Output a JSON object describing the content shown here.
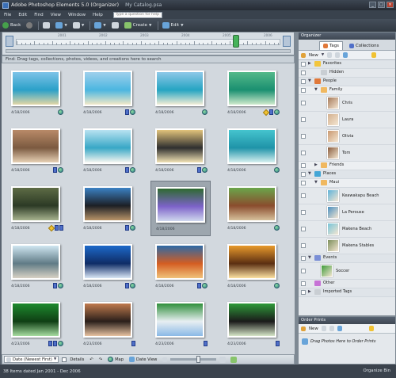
{
  "window": {
    "title": "Adobe Photoshop Elements 5.0 (Organizer)",
    "catalog": "My Catalog.psa"
  },
  "menu": {
    "items": [
      "File",
      "Edit",
      "Find",
      "View",
      "Window",
      "Help"
    ],
    "question_placeholder": "Type a question for help"
  },
  "toolbar": {
    "back_label": "Back",
    "create_label": "Create",
    "edit_label": "Edit"
  },
  "timeline": {
    "years": [
      "2001",
      "2002",
      "2003",
      "2004",
      "2005",
      "2006"
    ],
    "selected_position": 0.82
  },
  "find_bar": {
    "text": "Find: Drag tags, collections, photos, videos, and creations here to search"
  },
  "photos": [
    {
      "date": "4/18/2006",
      "palette": [
        "#7dc3e8",
        "#2aa0c8",
        "#e2d7a6"
      ],
      "badges": [
        "globe"
      ]
    },
    {
      "date": "4/18/2006",
      "palette": [
        "#9fd0ec",
        "#4bb6e0",
        "#f2e9c8"
      ],
      "badges": [
        "tag",
        "globe"
      ]
    },
    {
      "date": "4/18/2006",
      "palette": [
        "#8ec8e8",
        "#25a4c2",
        "#f3eed6"
      ],
      "badges": [
        "globe"
      ]
    },
    {
      "date": "4/18/2006",
      "palette": [
        "#54b98a",
        "#1a8f70",
        "#cfeacc"
      ],
      "badges": [
        "star",
        "tag",
        "globe"
      ]
    },
    {
      "date": "4/18/2006",
      "palette": [
        "#b98a68",
        "#7b5a40",
        "#e7d1b5"
      ],
      "badges": [
        "tag",
        "globe"
      ]
    },
    {
      "date": "4/18/2006",
      "palette": [
        "#b9e2f1",
        "#38a7c6",
        "#f6f6f1"
      ],
      "badges": [
        "tag",
        "globe"
      ]
    },
    {
      "date": "4/18/2006",
      "palette": [
        "#e2c37b",
        "#2f2f2f",
        "#f2e3b6"
      ],
      "badges": [
        "tag",
        "globe"
      ]
    },
    {
      "date": "4/18/2006",
      "palette": [
        "#45c4ce",
        "#1f93a8",
        "#d7f0f0"
      ],
      "badges": [
        "globe"
      ]
    },
    {
      "date": "4/18/2006",
      "palette": [
        "#5d6b45",
        "#2c3a25",
        "#a7b38e"
      ],
      "badges": [
        "star",
        "tag",
        "tag"
      ]
    },
    {
      "date": "4/18/2006",
      "palette": [
        "#3b82c4",
        "#1c1f25",
        "#b89468"
      ],
      "badges": [
        "tag",
        "globe"
      ]
    },
    {
      "date": "4/18/2006",
      "palette": [
        "#2e6a30",
        "#7d63c9",
        "#cfd8ee"
      ],
      "badges": []
    },
    {
      "date": "4/18/2006",
      "palette": [
        "#6aa64b",
        "#8a4c2d",
        "#d6c19c"
      ],
      "badges": [
        "globe"
      ]
    },
    {
      "date": "4/18/2006",
      "palette": [
        "#cfe6f1",
        "#607b86",
        "#d8d1c4"
      ],
      "badges": [
        "tag",
        "globe"
      ]
    },
    {
      "date": "4/18/2006",
      "palette": [
        "#1d69c9",
        "#0f2c66",
        "#d9e6f6"
      ],
      "badges": [
        "tag",
        "globe"
      ]
    },
    {
      "date": "4/18/2006",
      "palette": [
        "#2d6aa6",
        "#d45d22",
        "#f0c27a"
      ],
      "badges": [
        "tag",
        "globe"
      ]
    },
    {
      "date": "4/18/2006",
      "palette": [
        "#e89a2c",
        "#5b2f12",
        "#fce1a2"
      ],
      "badges": [
        "globe"
      ]
    },
    {
      "date": "4/23/2006",
      "palette": [
        "#1e8a2e",
        "#0f3f14",
        "#a6dca0"
      ],
      "badges": [
        "tag",
        "tag",
        "globe"
      ]
    },
    {
      "date": "4/23/2006",
      "palette": [
        "#c07a4e",
        "#2a1f1a",
        "#e7c2a1"
      ],
      "badges": [
        "tag"
      ]
    },
    {
      "date": "4/23/2006",
      "palette": [
        "#2f8f3b",
        "#e8eef2",
        "#8ab9e6"
      ],
      "badges": [
        "tag"
      ]
    },
    {
      "date": "4/23/2006",
      "palette": [
        "#2f9b3a",
        "#1a1a1a",
        "#d6e6c8"
      ],
      "badges": [
        "tag"
      ]
    }
  ],
  "status": {
    "sort_label": "Date (Newest First)",
    "details_label": "Details",
    "map_label": "Map",
    "date_view_label": "Date View"
  },
  "footer": {
    "items_text": "38 Items dated Jan 2001 - Dec 2006",
    "organize_bin": "Organize Bin"
  },
  "organizer": {
    "title": "Organizer",
    "tab_tags": "Tags",
    "tab_collections": "Collections",
    "new_label": "New",
    "rows": [
      {
        "label": "Favorites",
        "kind": "group",
        "icon": "#f2c53d",
        "indent": 20
      },
      {
        "label": "Hidden",
        "kind": "item",
        "icon": "#c9ced3",
        "indent": 28
      },
      {
        "label": "People",
        "kind": "group",
        "icon": "#e0783a",
        "indent": 20
      },
      {
        "label": "Family",
        "kind": "subgroup",
        "icon": "#f0b860",
        "indent": 28
      },
      {
        "label": "Chris",
        "kind": "tall",
        "thumb": "#a67b5b",
        "indent": 36
      },
      {
        "label": "Laura",
        "kind": "tall",
        "thumb": "#d3b08f",
        "indent": 36
      },
      {
        "label": "Olivia",
        "kind": "tall",
        "thumb": "#c99870",
        "indent": 36
      },
      {
        "label": "Tom",
        "kind": "tall",
        "thumb": "#8a5e3f",
        "indent": 36
      },
      {
        "label": "Friends",
        "kind": "subgroup",
        "icon": "#f0b860",
        "indent": 28
      },
      {
        "label": "Places",
        "kind": "group",
        "icon": "#43a6d6",
        "indent": 20
      },
      {
        "label": "Maui",
        "kind": "subgroup",
        "icon": "#f0b860",
        "indent": 28
      },
      {
        "label": "Keawakapu Beach",
        "kind": "tall",
        "thumb": "#5fb3d9",
        "indent": 36
      },
      {
        "label": "La Perouse",
        "kind": "tall",
        "thumb": "#4a8fbf",
        "indent": 36
      },
      {
        "label": "Makena Beach",
        "kind": "tall",
        "thumb": "#78c4d8",
        "indent": 36
      },
      {
        "label": "Makena Stables",
        "kind": "tall",
        "thumb": "#7d8f5c",
        "indent": 36
      },
      {
        "label": "Events",
        "kind": "group",
        "icon": "#7a8fd6",
        "indent": 20
      },
      {
        "label": "Soccer",
        "kind": "tall",
        "thumb": "#3d9a3a",
        "indent": 28
      },
      {
        "label": "Other",
        "kind": "item",
        "icon": "#c773d6",
        "indent": 20
      },
      {
        "label": "Imported Tags",
        "kind": "group",
        "icon": "#c9ced3",
        "indent": 20
      }
    ]
  },
  "order_prints": {
    "title": "Order Prints",
    "new_label": "New",
    "drop_text": "Drag Photos Here to Order Prints"
  }
}
